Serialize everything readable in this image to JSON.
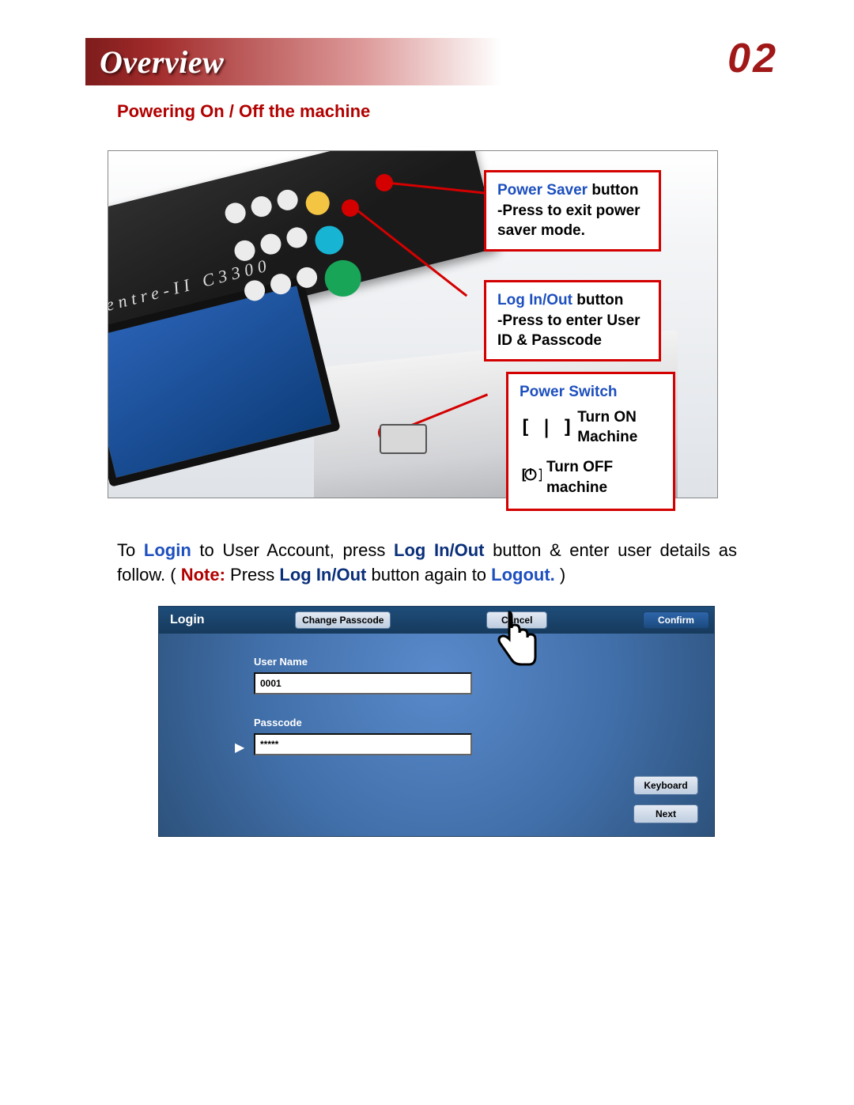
{
  "header": {
    "title": "Overview"
  },
  "page_number": "02",
  "subtitle": "Powering On / Off the machine",
  "device_model_label": "entre-II  C3300",
  "callouts": {
    "power_saver": {
      "title": "Power Saver",
      "title_suffix": " button",
      "line1": "-Press to exit power",
      "line2": "saver mode."
    },
    "log_in_out": {
      "title": "Log In/Out",
      "title_suffix": " button",
      "line1": "-Press to enter User",
      "line2": "ID & Passcode"
    },
    "power_switch": {
      "title": "Power Switch",
      "on_icon": "[ | ]",
      "on_text1": "Turn ON",
      "on_text2": "Machine",
      "off_text1": "Turn OFF",
      "off_text2": "machine"
    }
  },
  "paragraph": {
    "p1a": "To ",
    "p1b": "Login",
    "p1c": " to User Account, press ",
    "p1d": "Log In/Out",
    "p1e": " button & enter user details as follow. ( ",
    "p1f": "Note:",
    "p1g": " Press ",
    "p1h": "Log In/Out",
    "p1i": " button again to ",
    "p1j": "Logout.",
    "p1k": " )"
  },
  "login_panel": {
    "title": "Login",
    "change_passcode": "Change Passcode",
    "cancel": "Cancel",
    "confirm": "Confirm",
    "user_name_label": "User Name",
    "user_name_value": "0001",
    "passcode_label": "Passcode",
    "passcode_value": "*****",
    "keyboard": "Keyboard",
    "next": "Next"
  }
}
